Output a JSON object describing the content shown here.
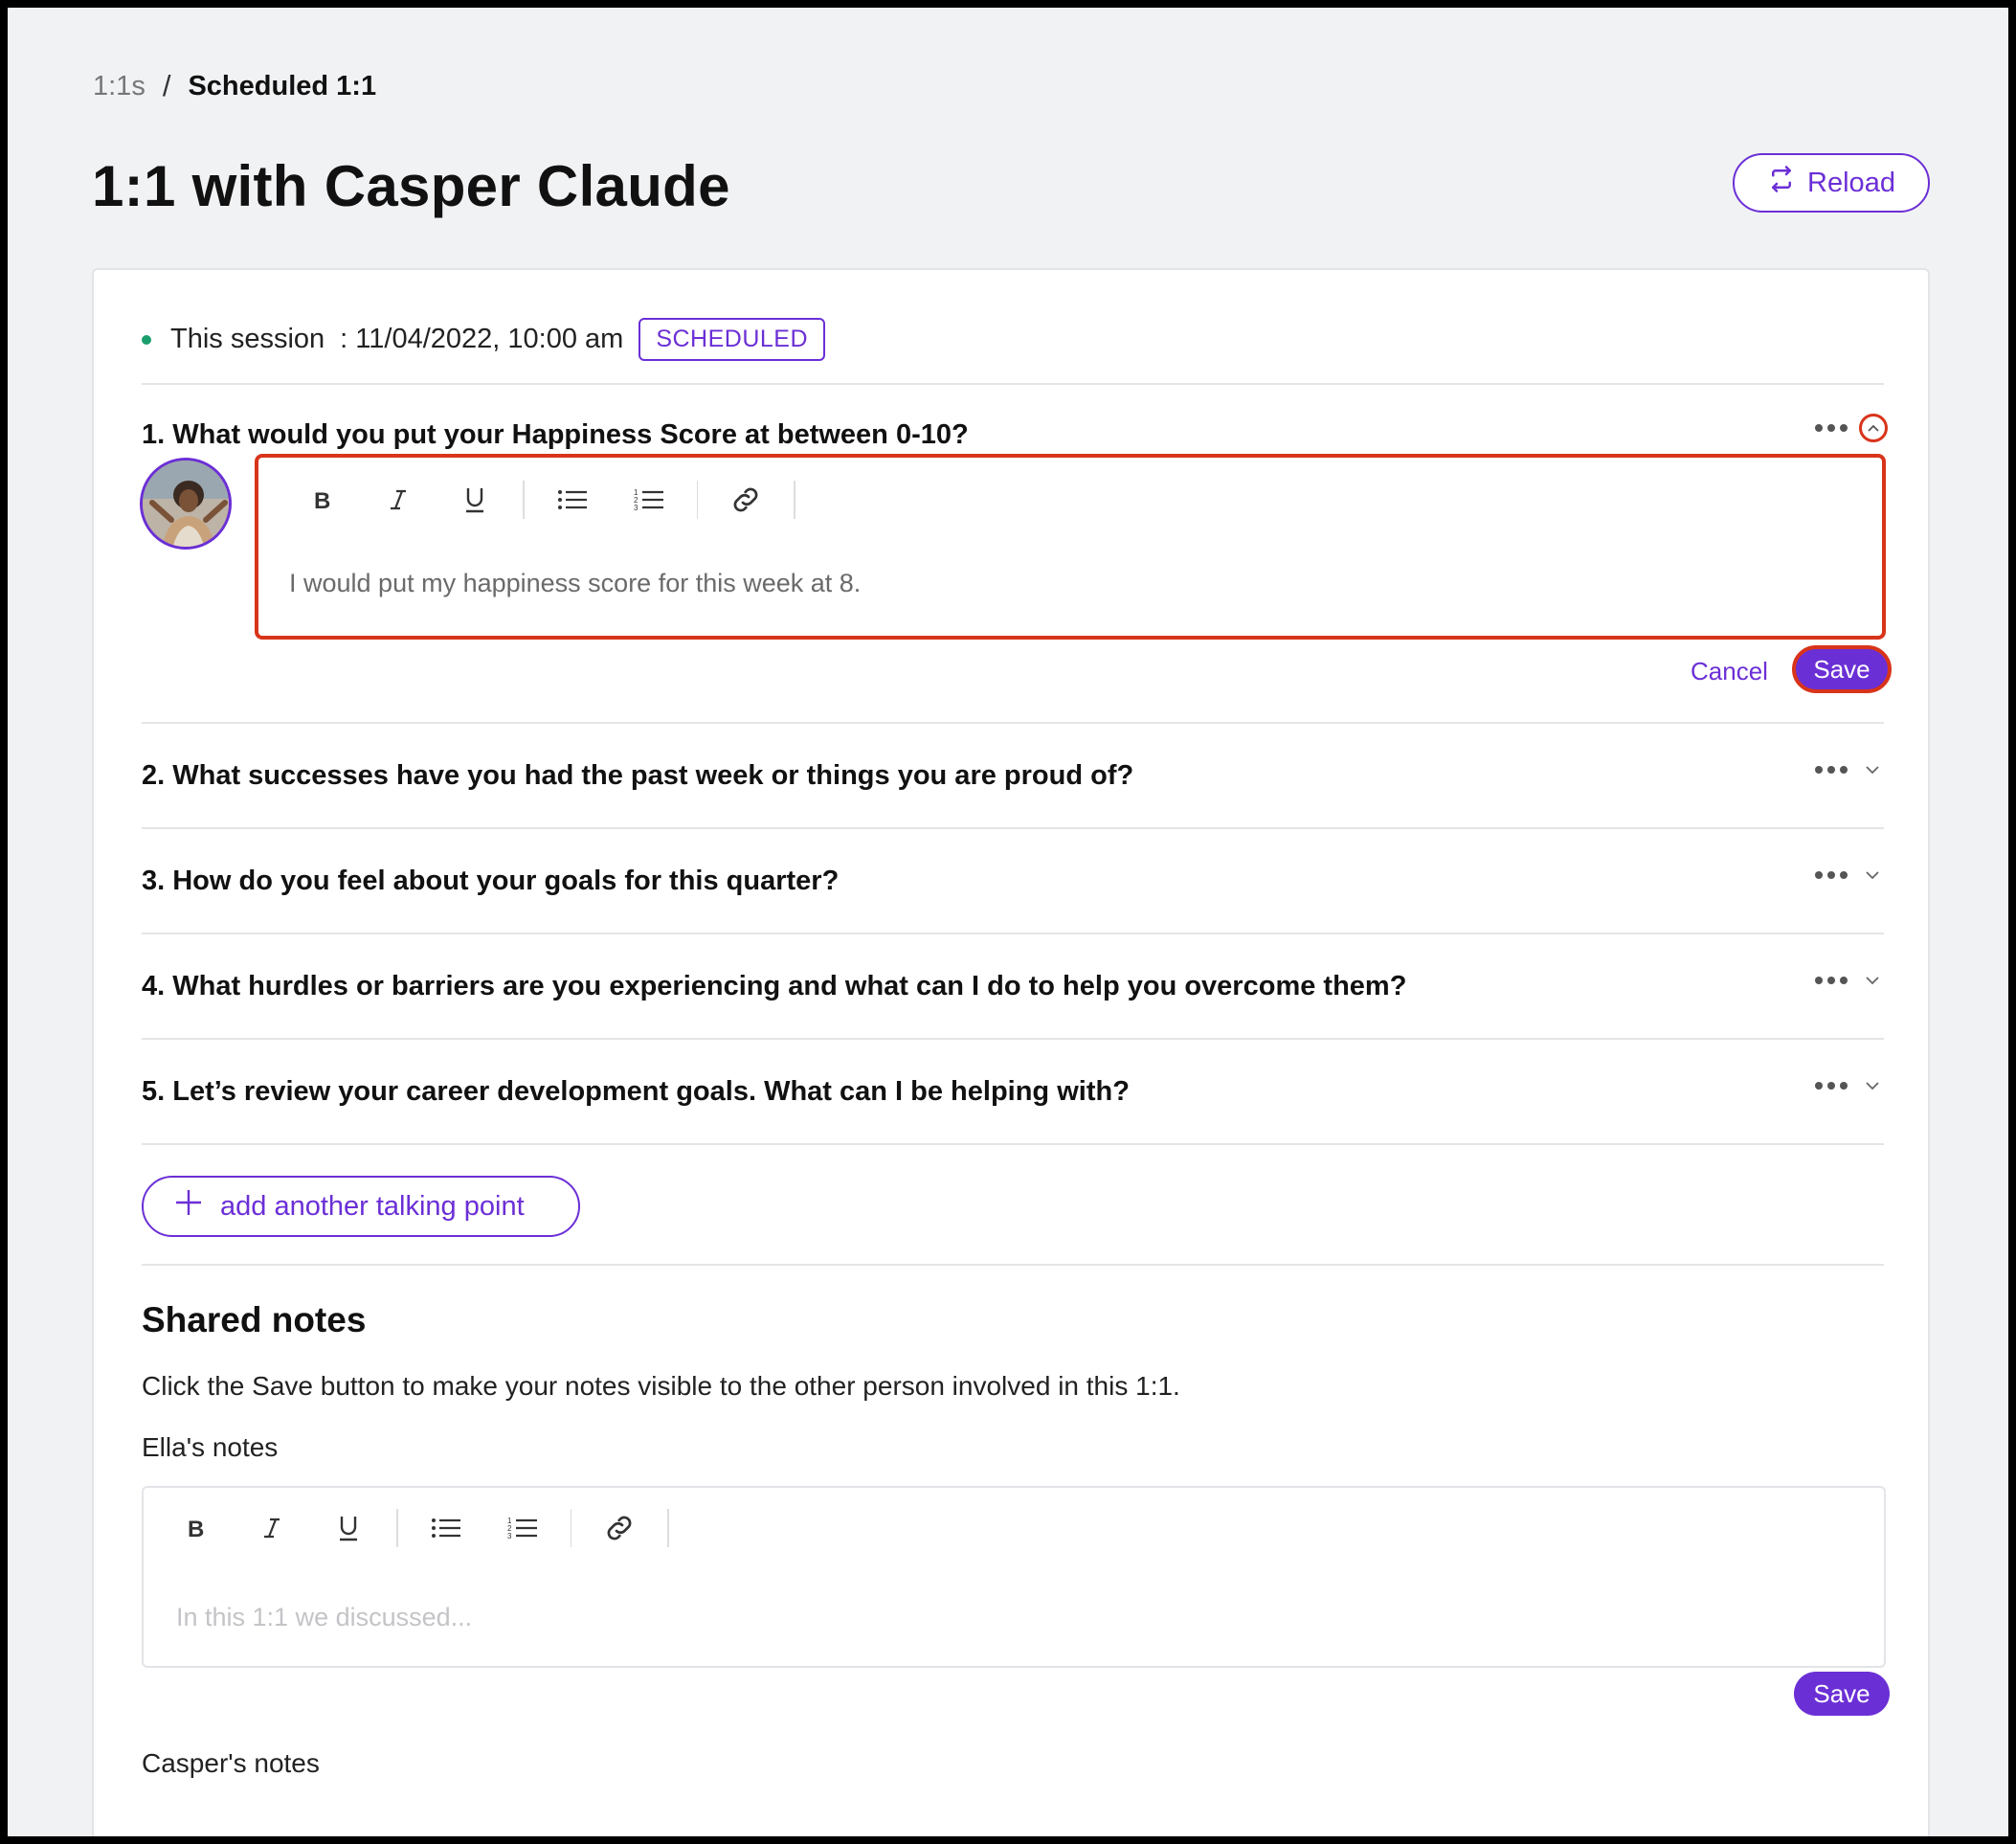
{
  "breadcrumb": {
    "parent": "1:1s",
    "separator": "/",
    "current": "Scheduled 1:1"
  },
  "page": {
    "title": "1:1 with Casper Claude"
  },
  "reload": {
    "label": "Reload",
    "icon": "reload-icon"
  },
  "session": {
    "label": "This session",
    "date": ": 11/04/2022, 10:00 am",
    "status": "SCHEDULED"
  },
  "questions": [
    {
      "text": "1. What would you put your Happiness Score at between 0-10?",
      "expanded": true
    },
    {
      "text": "2. What successes have you had the past week or things you are proud of?",
      "expanded": false
    },
    {
      "text": "3. How do you feel about your goals for this quarter?",
      "expanded": false
    },
    {
      "text": "4. What hurdles or barriers are you experiencing and what can I do to help you overcome them?",
      "expanded": false
    },
    {
      "text": "5. Let’s review your career development goals. What can I be helping with?",
      "expanded": false
    }
  ],
  "answer": {
    "text": "I would put my happiness score for this week at 8.",
    "cancel_label": "Cancel",
    "save_label": "Save"
  },
  "toolbar_icons": [
    "bold-icon",
    "italic-icon",
    "underline-icon",
    "bullet-list-icon",
    "numbered-list-icon",
    "link-icon"
  ],
  "add_point": {
    "label": "add another talking point"
  },
  "shared_notes": {
    "title": "Shared notes",
    "description": "Click the Save button to make your notes visible to the other person involved in this 1:1.",
    "ella_label": "Ella's notes",
    "ella_placeholder": "In this 1:1 we discussed...",
    "save_label": "Save",
    "casper_label": "Casper's notes"
  },
  "colors": {
    "accent": "#6b2fd6",
    "highlight": "#d8341a",
    "status_dot": "#1a9e6e"
  }
}
